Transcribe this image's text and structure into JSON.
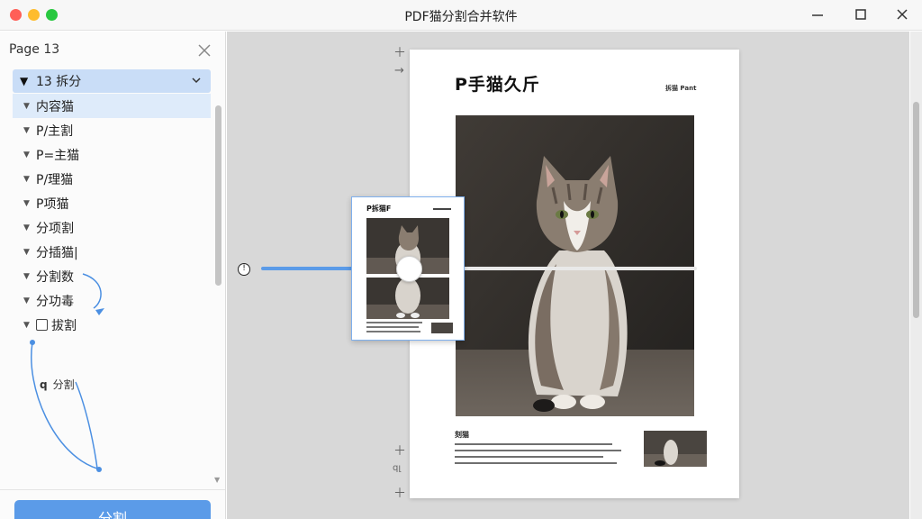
{
  "window": {
    "title": "PDF猫分割合并软件"
  },
  "sidebar": {
    "header": "Page 13",
    "root": {
      "label": "13 拆分"
    },
    "items": [
      {
        "label": "内容猫"
      },
      {
        "label": "P/主割"
      },
      {
        "label": "P=主猫"
      },
      {
        "label": "P/理猫"
      },
      {
        "label": "P项猫"
      },
      {
        "label": "分项割"
      },
      {
        "label": "分插猫|"
      },
      {
        "label": "分割数"
      },
      {
        "label": "分功毒"
      },
      {
        "label": "拔割"
      }
    ],
    "sub_item": {
      "icon_text": "q",
      "label": "分割"
    },
    "split_button": "分割"
  },
  "page": {
    "title": "P手猫久斤",
    "corner_label": "拆猫 Pant",
    "caption_title": "刻猫"
  },
  "preview": {
    "title": "P拆猫F"
  },
  "slider": {
    "value_fraction": 0.33,
    "icon_text": "!"
  },
  "colors": {
    "accent": "#5b9be8",
    "selection": "#c9ddf7",
    "canvas": "#d8d8d8"
  },
  "icons": [
    "close-icon",
    "minimize-icon",
    "maximize-icon",
    "chevron-down-icon",
    "plus-icon",
    "arrow-right-icon",
    "info-icon"
  ]
}
